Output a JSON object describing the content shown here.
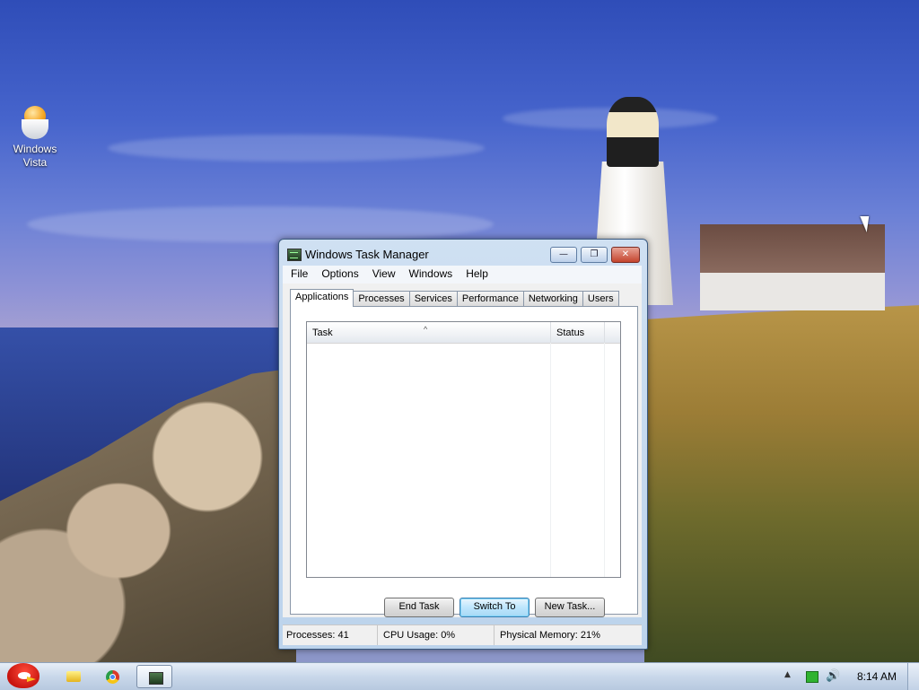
{
  "desktop": {
    "icons": [
      {
        "label": "Windows\nVista",
        "icon": "windows-vista-egg-icon"
      }
    ]
  },
  "window": {
    "title": "Windows Task Manager",
    "controls": {
      "minimize": "—",
      "maximize": "❐",
      "close": "✕"
    },
    "menu": [
      "File",
      "Options",
      "View",
      "Windows",
      "Help"
    ],
    "tabs": [
      {
        "label": "Applications",
        "active": true
      },
      {
        "label": "Processes",
        "active": false
      },
      {
        "label": "Services",
        "active": false
      },
      {
        "label": "Performance",
        "active": false
      },
      {
        "label": "Networking",
        "active": false
      },
      {
        "label": "Users",
        "active": false
      }
    ],
    "list": {
      "columns": [
        "Task",
        "Status"
      ],
      "sort_indicator": "^",
      "rows": []
    },
    "buttons": {
      "end_task": "End Task",
      "switch_to": "Switch To",
      "new_task": "New Task..."
    },
    "status": {
      "processes": "Processes: 41",
      "cpu": "CPU Usage: 0%",
      "memory": "Physical Memory: 21%"
    }
  },
  "taskbar": {
    "items": [
      "angry-birds-start-icon",
      "folder-icon",
      "chrome-icon",
      "task-manager-icon"
    ],
    "tray": {
      "arrow": "▲",
      "volume": "🔊",
      "clock": "8:14 AM"
    }
  }
}
